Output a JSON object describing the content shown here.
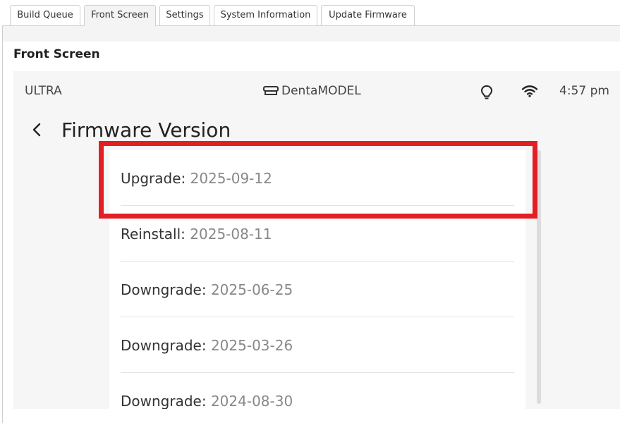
{
  "tabs": [
    {
      "label": "Build Queue",
      "active": false
    },
    {
      "label": "Front Screen",
      "active": true
    },
    {
      "label": "Settings",
      "active": false
    },
    {
      "label": "System Information",
      "active": false
    },
    {
      "label": "Update Firmware",
      "active": false
    }
  ],
  "section_title": "Front Screen",
  "screen": {
    "status_left": "ULTRA",
    "brand": "DentaMODEL",
    "time": "4:57 pm",
    "title": "Firmware Version",
    "items": [
      {
        "action": "Upgrade:",
        "date": "2025-09-12"
      },
      {
        "action": "Reinstall:",
        "date": "2025-08-11"
      },
      {
        "action": "Downgrade:",
        "date": "2025-06-25"
      },
      {
        "action": "Downgrade:",
        "date": "2025-03-26"
      },
      {
        "action": "Downgrade:",
        "date": "2024-08-30"
      }
    ]
  },
  "colors": {
    "highlight": "#e31e24",
    "panel_bg": "#f4f4f4",
    "date_text": "#888888"
  }
}
